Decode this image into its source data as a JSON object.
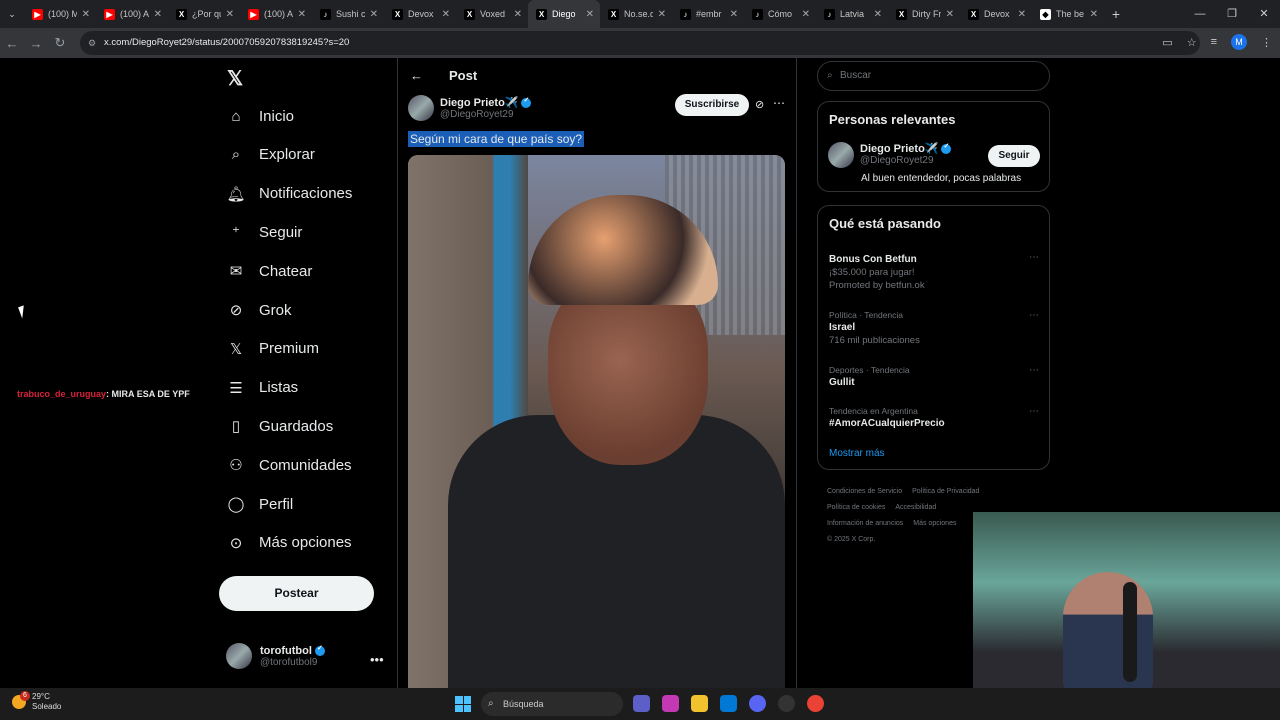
{
  "browser": {
    "tabs": [
      {
        "title": "(100) M",
        "icon": "youtube-icon",
        "color": "#ff0000"
      },
      {
        "title": "(100) A",
        "icon": "youtube-icon",
        "color": "#ff0000"
      },
      {
        "title": "¿Por qu",
        "icon": "x-icon",
        "color": "#000000"
      },
      {
        "title": "(100) A",
        "icon": "youtube-icon",
        "color": "#ff0000"
      },
      {
        "title": "Sushi c",
        "icon": "tiktok-icon",
        "color": "#000000"
      },
      {
        "title": "Devox",
        "icon": "x-icon",
        "color": "#000000"
      },
      {
        "title": "Voxed",
        "icon": "x-icon",
        "color": "#000000"
      },
      {
        "title": "Diego",
        "icon": "x-icon",
        "color": "#000000",
        "active": true
      },
      {
        "title": "No.se.q",
        "icon": "x-icon",
        "color": "#000000"
      },
      {
        "title": "#embr",
        "icon": "tiktok-icon",
        "color": "#000000"
      },
      {
        "title": "Cómo",
        "icon": "tiktok-icon",
        "color": "#000000"
      },
      {
        "title": "Latvia",
        "icon": "tiktok-icon",
        "color": "#000000"
      },
      {
        "title": "Dirty Fr",
        "icon": "x-icon",
        "color": "#000000"
      },
      {
        "title": "Devox",
        "icon": "x-icon",
        "color": "#000000"
      },
      {
        "title": "The be",
        "icon": "diamond-icon",
        "color": "#ffffff"
      }
    ],
    "url": "x.com/DiegoRoyet29/status/2000705920783819245?s=20",
    "profile_initial": "M"
  },
  "stream_chat": {
    "user": "trabuco_de_uruguay",
    "message": ": MIRA ESA DE YPF"
  },
  "nav": {
    "items": [
      "Inicio",
      "Explorar",
      "Notificaciones",
      "Seguir",
      "Chatear",
      "Grok",
      "Premium",
      "Listas",
      "Guardados",
      "Comunidades",
      "Perfil",
      "Más opciones"
    ],
    "post_button": "Postear",
    "account_name": "torofutbol",
    "account_handle": "@torofutbol9"
  },
  "post": {
    "header": "Post",
    "author_name": "Diego Prieto✈️",
    "author_handle": "@DiegoRoyet29",
    "subscribe_label": "Suscribirse",
    "text": "Según mi cara de que país soy?"
  },
  "sidebar": {
    "search_placeholder": "Buscar",
    "relevant_title": "Personas relevantes",
    "relevant_name": "Diego Prieto✈️",
    "relevant_handle": "@DiegoRoyet29",
    "relevant_bio": "Al buen entendedor, pocas palabras",
    "follow_label": "Seguir",
    "trending_title": "Qué está pasando",
    "trends": [
      {
        "category": "",
        "name": "Bonus Con Betfun",
        "sub": "¡$35.000 para jugar!",
        "extra": "Promoted by betfun.ok"
      },
      {
        "category": "Política · Tendencia",
        "name": "Israel",
        "sub": "716 mil publicaciones",
        "extra": ""
      },
      {
        "category": "Deportes · Tendencia",
        "name": "Gullit",
        "sub": "",
        "extra": ""
      },
      {
        "category": "Tendencia en Argentina",
        "name": "#AmorACualquierPrecio",
        "sub": "",
        "extra": ""
      }
    ],
    "show_more": "Mostrar más",
    "footer": {
      "links": [
        "Condiciones de Servicio",
        "Política de Privacidad",
        "Política de cookies",
        "Accesibilidad",
        "Información de anuncios",
        "Más opciones"
      ],
      "copyright": "© 2025 X Corp."
    }
  },
  "taskbar": {
    "temp": "29°C",
    "condition": "Soleado",
    "weather_badge": "6",
    "search_placeholder": "Búsqueda"
  }
}
